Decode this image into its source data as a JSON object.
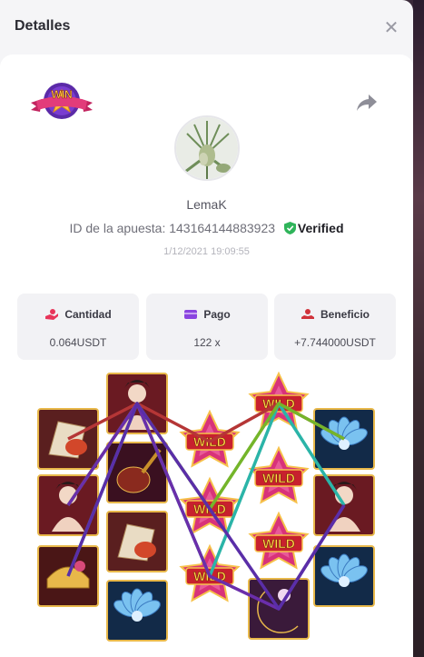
{
  "header": {
    "title": "Detalles",
    "close_icon": "close-icon"
  },
  "badge": {
    "text": "WIN",
    "icon": "win-star-badge-icon"
  },
  "share": {
    "icon": "share-icon"
  },
  "player": {
    "username": "LemaK",
    "avatar": "avatar-cannabis-photo"
  },
  "bet": {
    "id_label": "ID de la apuesta:",
    "id_value": "143164144883923",
    "verified_label": "Verified",
    "timestamp": "1/12/2021 19:09:55"
  },
  "stats": [
    {
      "label": "Cantidad",
      "value": "0.064USDT",
      "icon": "hand-coins-icon",
      "color": "#e8345a"
    },
    {
      "label": "Pago",
      "value": "122 x",
      "icon": "wallet-icon",
      "color": "#8a44e0"
    },
    {
      "label": "Beneficio",
      "value": "+7.744000USDT",
      "icon": "coin-stack-icon",
      "color": "#d0323a"
    }
  ],
  "slot": {
    "wild_label": "WILD",
    "reels": [
      [
        "fan",
        "lady",
        "comb"
      ],
      [
        "lady",
        "lute",
        "fan",
        "lotus"
      ],
      [
        "wild",
        "wild",
        "wild"
      ],
      [
        "wild",
        "wild",
        "wild",
        "moon"
      ],
      [
        "lotus",
        "lady",
        "lotus"
      ]
    ],
    "paylines": [
      {
        "color": "#b53636"
      },
      {
        "color": "#2bb4a8"
      },
      {
        "color": "#74b52a"
      },
      {
        "color": "#6a2eaa"
      },
      {
        "color": "#5a2ea8"
      }
    ]
  }
}
